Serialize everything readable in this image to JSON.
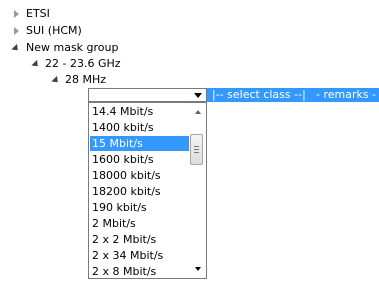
{
  "tree": {
    "etsi": "ETSI",
    "sui": "SUI (HCM)",
    "mask_group": "New mask group",
    "band": "22 - 23.6 GHz",
    "channel": "28 MHz"
  },
  "row": {
    "select_class": "|-- select class --|",
    "remarks": "- remarks -"
  },
  "dropdown": {
    "selected": "15 Mbit/s",
    "options": [
      "14.4 Mbit/s",
      "1400 kbit/s",
      "15 Mbit/s",
      "1600 kbit/s",
      "18000 kbit/s",
      "18200 kbit/s",
      "190 kbit/s",
      "2 Mbit/s",
      "2 x 2 Mbit/s",
      "2 x 34 Mbit/s",
      "2 x 8 Mbit/s"
    ]
  },
  "colors": {
    "highlight": "#3399ff"
  }
}
